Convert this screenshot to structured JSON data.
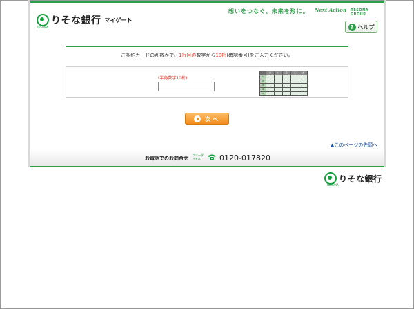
{
  "header": {
    "bank_name": "りそな銀行",
    "service_name": "マイゲート",
    "logo_small": "RESONA",
    "slogan": "想いをつなぐ、未来を形に。",
    "slogan_script": "Next Action",
    "group_name": "RESONA GROUP",
    "help_label": "ヘルプ",
    "help_icon": "question-icon"
  },
  "main": {
    "instruction_pre": "ご契約カードの乱数表で、",
    "instruction_red1": "1行目の",
    "instruction_mid": "数字から",
    "instruction_red2": "10桁",
    "instruction_post": "(確認番号)をご入力ください。",
    "input_hint": "(半角数字10桁)",
    "input_value": "",
    "card_grid": {
      "columns": [
        "あ",
        "い",
        "う",
        "え",
        "お"
      ],
      "rows": [
        "1",
        "2",
        "3",
        "4",
        "5"
      ]
    },
    "next_label": "次へ",
    "to_top": "このページの先頭へ"
  },
  "contact": {
    "label": "お電話でのお問合せ",
    "free_dial": "フリーダイヤル",
    "number": "0120-017820"
  },
  "footer": {
    "bank_name": "りそな銀行",
    "logo_small": "RESONA"
  },
  "colors": {
    "brand_green": "#2e9e4a",
    "accent_orange": "#f08a16",
    "highlight_red": "#e03020",
    "link_blue": "#1a4fa0"
  }
}
